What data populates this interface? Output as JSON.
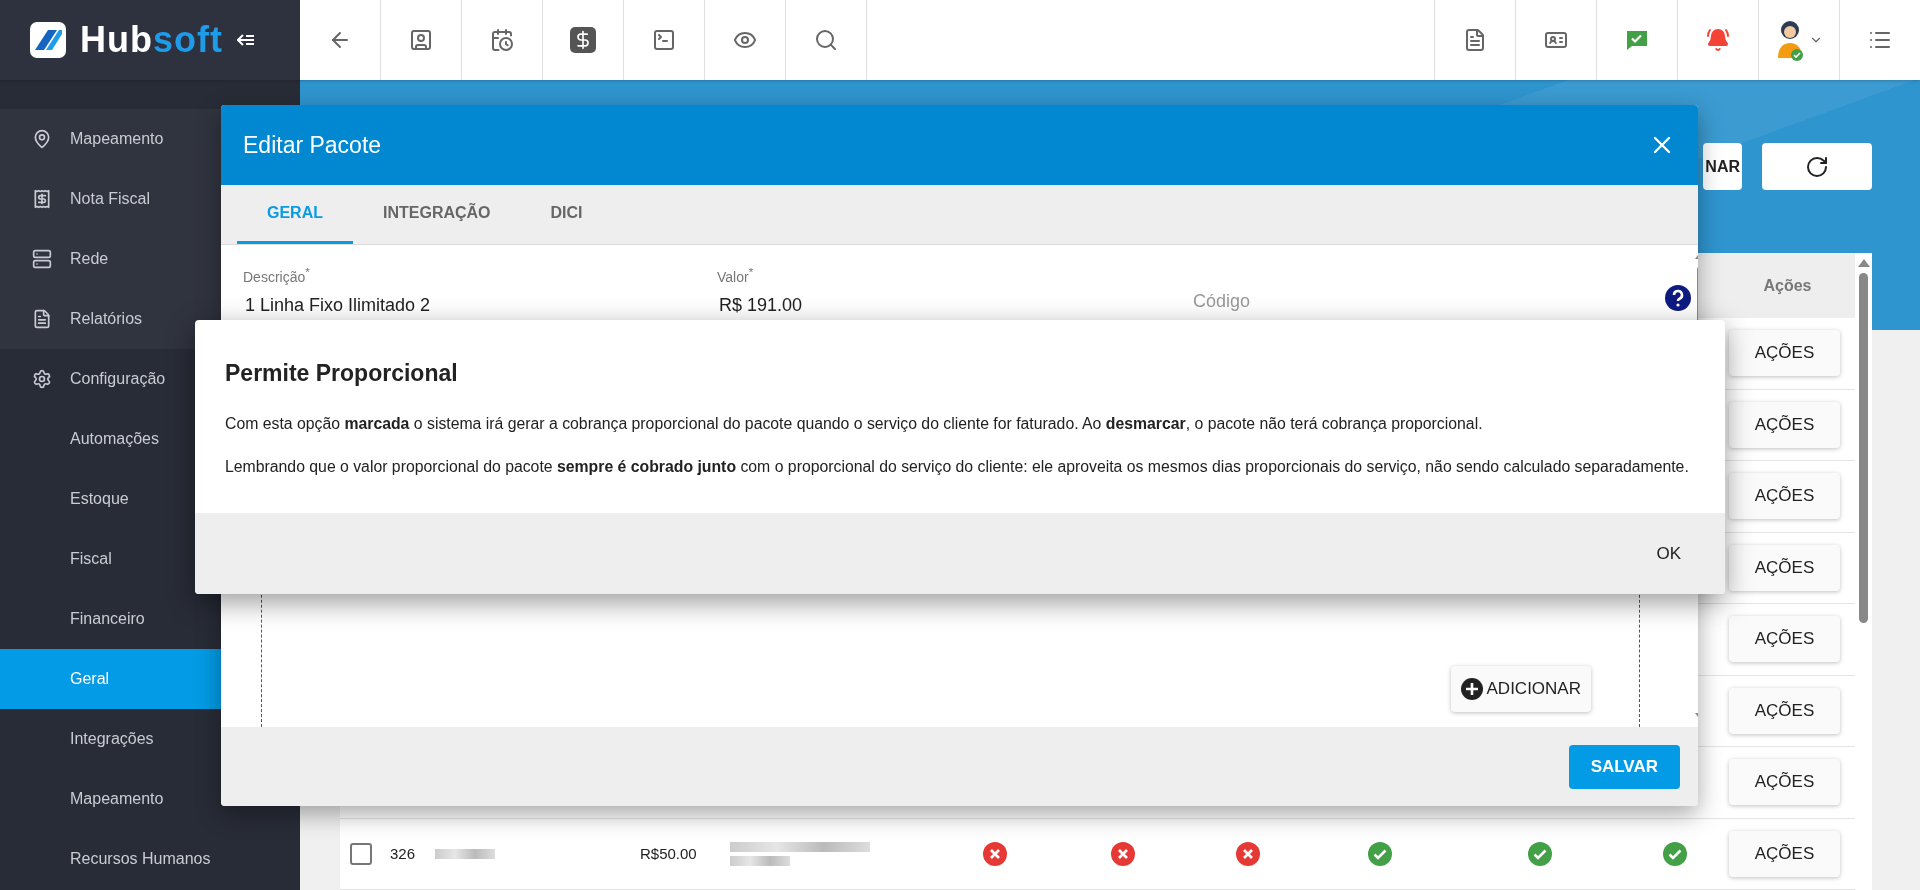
{
  "topbar": {
    "logo": {
      "parts": [
        {
          "text": "Hub",
          "color": "#ffffff"
        },
        {
          "text": "soft",
          "color": "#1e9be9"
        }
      ]
    }
  },
  "sidebar": {
    "items": [
      {
        "label": "Mapeamento",
        "kind": "module",
        "selected": false
      },
      {
        "label": "Nota Fiscal",
        "kind": "module",
        "selected": false
      },
      {
        "label": "Rede",
        "kind": "module",
        "selected": false
      },
      {
        "label": "Relatórios",
        "kind": "module",
        "selected": false
      },
      {
        "label": "Configuração",
        "kind": "section",
        "selected": false
      },
      {
        "label": "Automações",
        "kind": "subitem",
        "selected": false
      },
      {
        "label": "Estoque",
        "kind": "subitem",
        "selected": false
      },
      {
        "label": "Fiscal",
        "kind": "subitem",
        "selected": false
      },
      {
        "label": "Financeiro",
        "kind": "subitem",
        "selected": false
      },
      {
        "label": "Geral",
        "kind": "subitem",
        "selected": true
      },
      {
        "label": "Integrações",
        "kind": "subitem",
        "selected": false
      },
      {
        "label": "Mapeamento",
        "kind": "subitem",
        "selected": false
      },
      {
        "label": "Recursos Humanos",
        "kind": "subitem",
        "selected": false
      }
    ]
  },
  "toolbar": {
    "buttons": [
      {
        "label": "NAR"
      }
    ]
  },
  "table": {
    "columns": [
      {
        "label": "Ações"
      }
    ],
    "rows": [
      {
        "action": "AÇÕES"
      },
      {
        "action": "AÇÕES"
      },
      {
        "action": "AÇÕES"
      },
      {
        "action": "AÇÕES"
      },
      {
        "action": "AÇÕES"
      },
      {
        "action": "AÇÕES"
      },
      {
        "action": "AÇÕES"
      },
      {
        "checked": false,
        "id": "326",
        "price": "R$50.00",
        "flags": [
          false,
          false,
          false,
          true,
          true,
          true
        ],
        "action": "AÇÕES"
      }
    ]
  },
  "edit_dialog": {
    "title": "Editar Pacote",
    "tabs": [
      {
        "label": "GERAL",
        "selected": true
      },
      {
        "label": "INTEGRAÇÃO",
        "selected": false
      },
      {
        "label": "DICI",
        "selected": false
      }
    ],
    "fields": [
      {
        "label": "Descrição$^{*}$",
        "value": "1 Linha Fixo Ilimitado 2"
      },
      {
        "label": "Valor$^{*}$",
        "value": "R$ 191.00"
      },
      {
        "placeholder": "Código"
      }
    ],
    "add_button": "ADICIONAR",
    "save_button": "SALVAR"
  },
  "info_dialog": {
    "title": "Permite Proporcional",
    "paragraphs": [
      "Com esta opção **marcada** o sistema irá gerar a cobrança proporcional do pacote quando o serviço do cliente for faturado. Ao **desmarcar**, o pacote não terá cobrança proporcional.",
      "Lembrando que o valor proporcional do pacote **sempre é cobrado junto** com o proporcional do serviço do cliente: ele aproveita os mesmos dias proporcionais do serviço, não sendo calculado separadamente."
    ],
    "ok_button": "OK"
  }
}
